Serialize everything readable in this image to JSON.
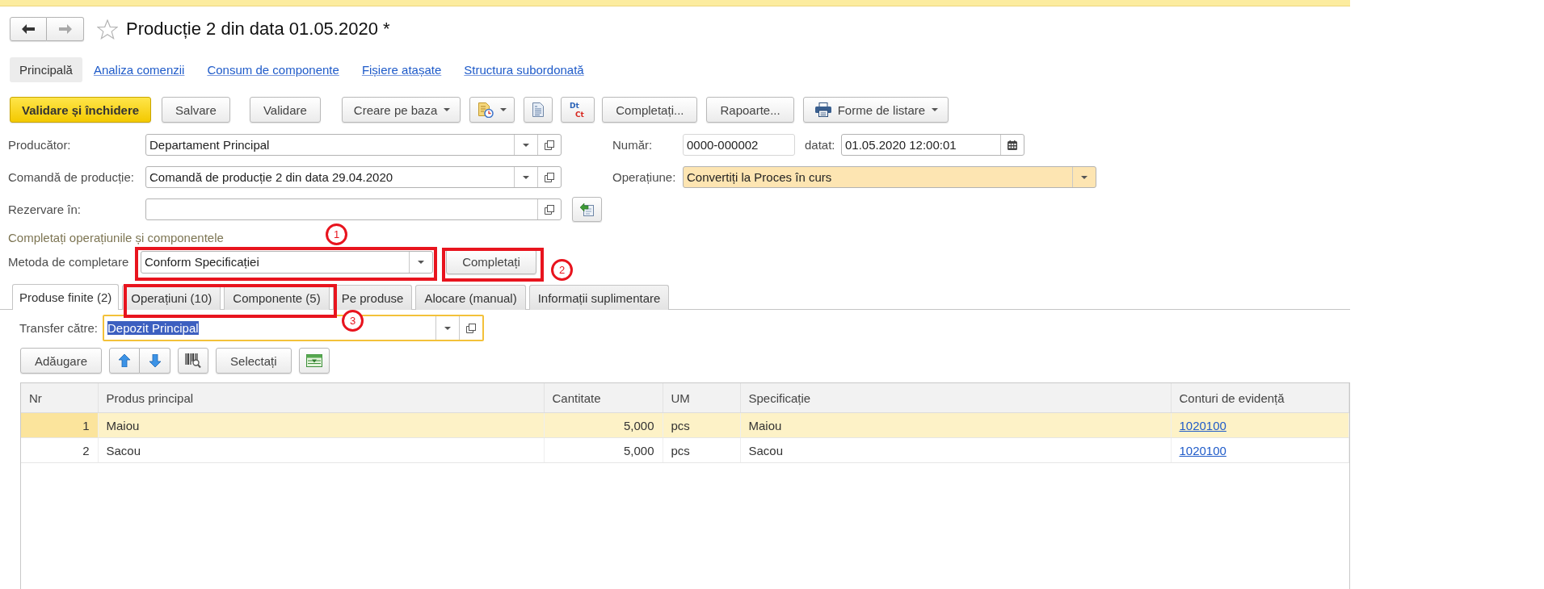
{
  "window": {
    "title": "Producție 2 din data 01.05.2020 *",
    "favorite": false
  },
  "nav": {
    "back_enabled": true,
    "forward_enabled": false
  },
  "sections": [
    {
      "label": "Principală",
      "selected": true
    },
    {
      "label": "Analiza comenzii",
      "selected": false
    },
    {
      "label": "Consum de componente",
      "selected": false
    },
    {
      "label": "Fișiere atașate",
      "selected": false
    },
    {
      "label": "Structura subordonată",
      "selected": false
    }
  ],
  "toolbar": [
    {
      "kind": "primary",
      "label": "Validare și închidere"
    },
    {
      "kind": "button",
      "label": "Salvare"
    },
    {
      "kind": "button",
      "label": "Validare"
    },
    {
      "kind": "menu",
      "label": "Creare pe baza"
    },
    {
      "kind": "report-menu"
    },
    {
      "kind": "document"
    },
    {
      "kind": "posting",
      "top": "Dt",
      "bottom": "Ct"
    },
    {
      "kind": "button",
      "label": "Completați..."
    },
    {
      "kind": "button",
      "label": "Rapoarte..."
    },
    {
      "kind": "print-menu",
      "label": "Forme de listare"
    }
  ],
  "form_rows": [
    {
      "fields": [
        {
          "label": "Producător:",
          "value": "Departament Principal",
          "kind": "ref",
          "highlighted": false
        },
        {
          "label": "Număr:",
          "value": "0000-000002",
          "kind": "text",
          "highlighted": false
        },
        {
          "label": "datat:",
          "value": "01.05.2020 12:00:01",
          "kind": "date",
          "highlighted": false
        }
      ]
    },
    {
      "fields": [
        {
          "label": "Comandă de producție:",
          "value": "Comandă de producție 2 din data 29.04.2020",
          "kind": "ref",
          "highlighted": false
        },
        {
          "label": "Operațiune:",
          "value": "Convertiți la Proces în curs",
          "kind": "choice",
          "highlighted": true
        }
      ]
    },
    {
      "fields": [
        {
          "label": "Rezervare în:",
          "kind": "lookup",
          "highlighted": false,
          "side_button": true
        }
      ]
    }
  ],
  "fill_group": {
    "title": "Completați operațiunile și componentele",
    "field": {
      "label": "Metoda de completare",
      "value": "Conform Specificației",
      "kind": "choice",
      "highlighted": false
    },
    "button": "Completați"
  },
  "callouts": [
    {
      "number": "1"
    },
    {
      "number": "2"
    },
    {
      "number": "3"
    }
  ],
  "tabs": [
    {
      "label": "Produse finite (2)",
      "selected": true
    },
    {
      "label": "Operațiuni (10)",
      "selected": false
    },
    {
      "label": "Componente (5)",
      "selected": false
    },
    {
      "label": "Pe produse",
      "selected": false
    },
    {
      "label": "Alocare (manual)",
      "selected": false
    },
    {
      "label": "Informații suplimentare",
      "selected": false
    }
  ],
  "transfer": {
    "label": "Transfer către:",
    "value": "Depozit Principal",
    "kind": "ref",
    "focused": true
  },
  "table_toolbar": [
    {
      "kind": "button",
      "label": "Adăugare"
    },
    {
      "kind": "move-up"
    },
    {
      "kind": "move-down"
    },
    {
      "kind": "barcode"
    },
    {
      "kind": "button",
      "label": "Selectați"
    },
    {
      "kind": "fill-table"
    }
  ],
  "table": {
    "columns": [
      "Nr",
      "Produs principal",
      "Cantitate",
      "UM",
      "Specificație",
      "Conturi de evidență"
    ],
    "rows": [
      {
        "cells": [
          "1",
          "Maiou",
          "5,000",
          "pcs",
          "Maiou",
          "1020100"
        ],
        "selected": true
      },
      {
        "cells": [
          "2",
          "Sacou",
          "5,000",
          "pcs",
          "Sacou",
          "1020100"
        ],
        "selected": false
      }
    ]
  }
}
